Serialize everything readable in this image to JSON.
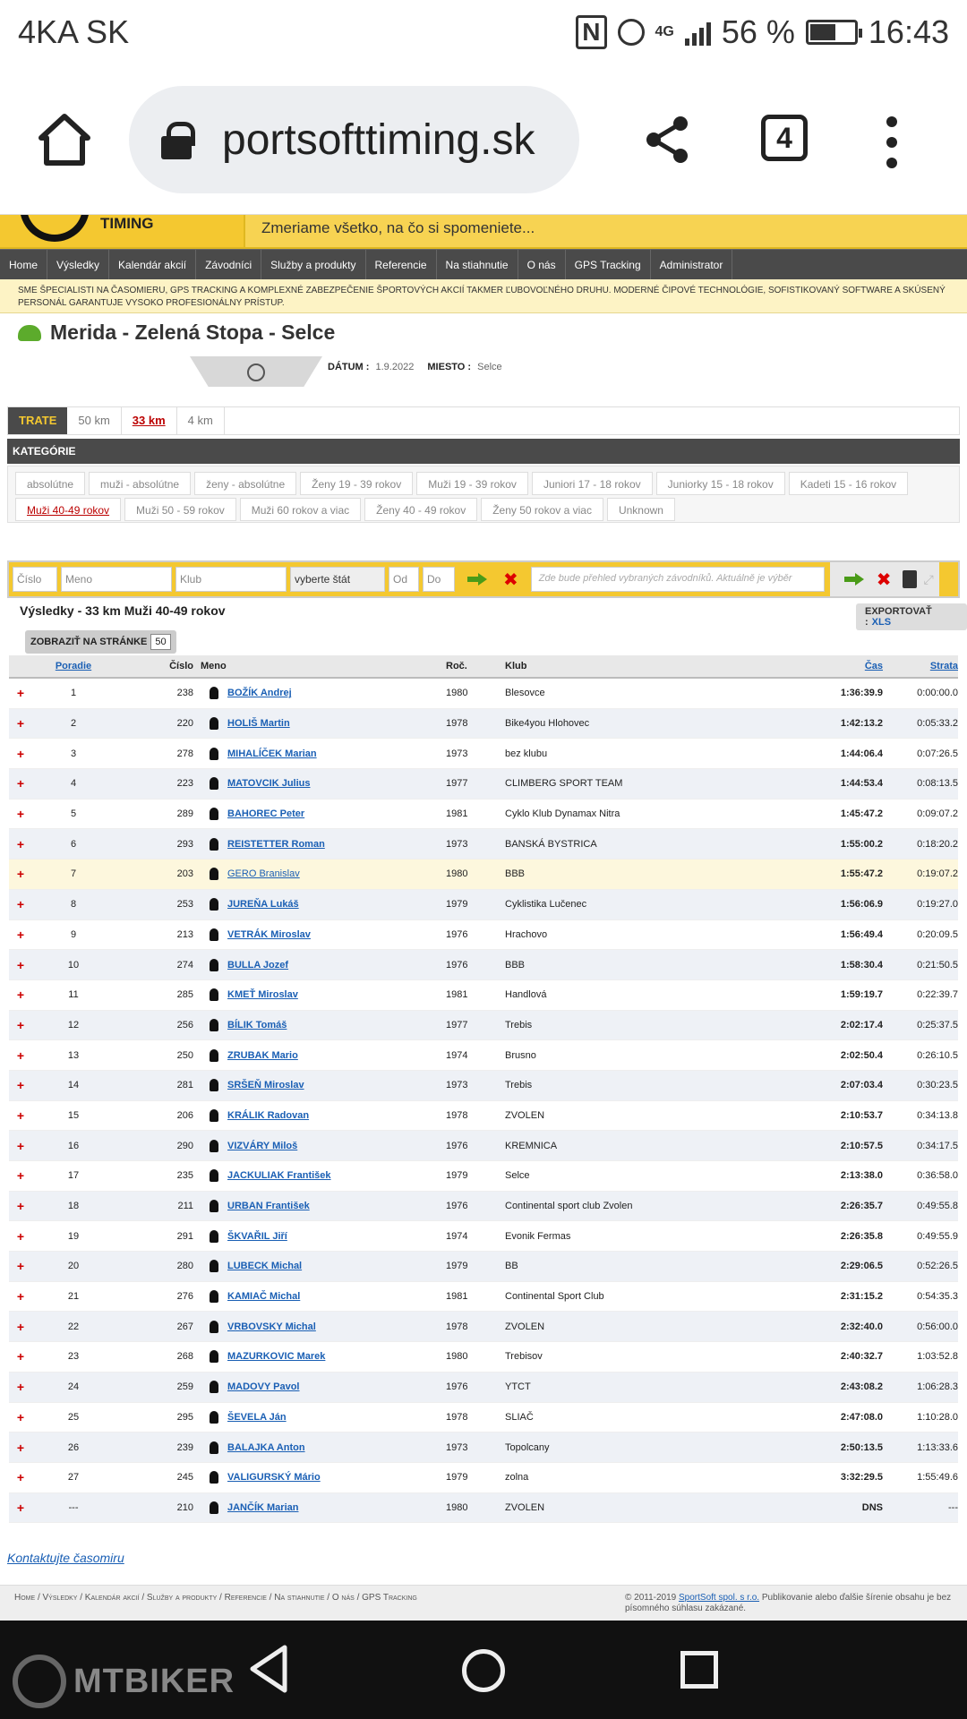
{
  "status": {
    "carrier": "4KA SK",
    "battery": "56 %",
    "time": "16:43",
    "signal": "4G"
  },
  "browser": {
    "url": "portsofttiming.sk",
    "tabs": "4"
  },
  "site": {
    "logo_text": "TIMING",
    "tagline": "Zmeriame všetko, na čo si spomeniete...",
    "nav": [
      "Home",
      "Výsledky",
      "Kalendár akcií",
      "Závodníci",
      "Služby a produkty",
      "Referencie",
      "Na stiahnutie",
      "O nás",
      "GPS Tracking",
      "Administrator"
    ],
    "notice": "Sme špecialisti na časomieru, GPS tracking a komplexné zabezpečenie športových akcií takmer ľubovoľného druhu. Moderné čipové technológie, sofistikovaný software a skúsený personál garantuje vysoko profesionálny prístup."
  },
  "event": {
    "title": "Merida - Zelená Stopa - Selce",
    "date_label": "DÁTUM :",
    "date": "1.9.2022",
    "place_label": "MIESTO :",
    "place": "Selce"
  },
  "tracks": {
    "label": "TRATE",
    "items": [
      "50 km",
      "33 km",
      "4 km"
    ]
  },
  "categories": {
    "label": "KATEGÓRIE",
    "items": [
      "absolútne",
      "muži - absolútne",
      "ženy - absolútne",
      "Ženy 19 - 39 rokov",
      "Muži 19 - 39 rokov",
      "Juniori 17 - 18 rokov",
      "Juniorky 15 - 18 rokov",
      "Kadeti 15 - 16 rokov",
      "Muži 40-49 rokov",
      "Muži 50 - 59 rokov",
      "Muži 60 rokov a viac",
      "Ženy 40 - 49 rokov",
      "Ženy 50 rokov a viac",
      "Unknown"
    ]
  },
  "filter": {
    "cislo": "Číslo",
    "meno": "Meno",
    "klub": "Klub",
    "stat": "vyberte štát",
    "od": "Od",
    "do": "Do",
    "preview": "Zde bude přehled vybraných závodníků. Aktuálně je výběr"
  },
  "results": {
    "heading": "Výsledky - 33 km Muži 40-49 rokov",
    "export_label": "EXPORTOVAŤ :",
    "export_xls": "XLS",
    "perpage_label": "ZOBRAZIŤ NA STRÁNKE",
    "perpage": "50"
  },
  "table": {
    "headers": {
      "poradie": "Poradie",
      "cislo": "Číslo",
      "meno": "Meno",
      "roc": "Roč.",
      "klub": "Klub",
      "cas": "Čas",
      "strata": "Strata"
    },
    "rows": [
      {
        "p": "1",
        "c": "238",
        "m": "BOŽÍK Andrej",
        "r": "1980",
        "k": "Blesovce",
        "t": "1:36:39.9",
        "s": "0:00:00.0"
      },
      {
        "p": "2",
        "c": "220",
        "m": "HOLIŠ Martin",
        "r": "1978",
        "k": "Bike4you Hlohovec",
        "t": "1:42:13.2",
        "s": "0:05:33.2"
      },
      {
        "p": "3",
        "c": "278",
        "m": "MIHALÍČEK Marian",
        "r": "1973",
        "k": "bez klubu",
        "t": "1:44:06.4",
        "s": "0:07:26.5"
      },
      {
        "p": "4",
        "c": "223",
        "m": "MATOVCIK Julius",
        "r": "1977",
        "k": "CLIMBERG SPORT TEAM",
        "t": "1:44:53.4",
        "s": "0:08:13.5"
      },
      {
        "p": "5",
        "c": "289",
        "m": "BAHOREC Peter",
        "r": "1981",
        "k": "Cyklo Klub Dynamax Nitra",
        "t": "1:45:47.2",
        "s": "0:09:07.2"
      },
      {
        "p": "6",
        "c": "293",
        "m": "REISTETTER Roman",
        "r": "1973",
        "k": "BANSKÁ BYSTRICA",
        "t": "1:55:00.2",
        "s": "0:18:20.2"
      },
      {
        "p": "7",
        "c": "203",
        "m": "GERO Branislav",
        "r": "1980",
        "k": "BBB",
        "t": "1:55:47.2",
        "s": "0:19:07.2"
      },
      {
        "p": "8",
        "c": "253",
        "m": "JUREŇA Lukáš",
        "r": "1979",
        "k": "Cyklistika Lučenec",
        "t": "1:56:06.9",
        "s": "0:19:27.0"
      },
      {
        "p": "9",
        "c": "213",
        "m": "VETRÁK Miroslav",
        "r": "1976",
        "k": "Hrachovo",
        "t": "1:56:49.4",
        "s": "0:20:09.5"
      },
      {
        "p": "10",
        "c": "274",
        "m": "BULLA Jozef",
        "r": "1976",
        "k": "BBB",
        "t": "1:58:30.4",
        "s": "0:21:50.5"
      },
      {
        "p": "11",
        "c": "285",
        "m": "KMEŤ Miroslav",
        "r": "1981",
        "k": "Handlová",
        "t": "1:59:19.7",
        "s": "0:22:39.7"
      },
      {
        "p": "12",
        "c": "256",
        "m": "BÍLIK Tomáš",
        "r": "1977",
        "k": "Trebis",
        "t": "2:02:17.4",
        "s": "0:25:37.5"
      },
      {
        "p": "13",
        "c": "250",
        "m": "ZRUBAK Mario",
        "r": "1974",
        "k": "Brusno",
        "t": "2:02:50.4",
        "s": "0:26:10.5"
      },
      {
        "p": "14",
        "c": "281",
        "m": "SRŠEŇ Miroslav",
        "r": "1973",
        "k": "Trebis",
        "t": "2:07:03.4",
        "s": "0:30:23.5"
      },
      {
        "p": "15",
        "c": "206",
        "m": "KRÁLIK Radovan",
        "r": "1978",
        "k": "ZVOLEN",
        "t": "2:10:53.7",
        "s": "0:34:13.8"
      },
      {
        "p": "16",
        "c": "290",
        "m": "VIZVÁRY Miloš",
        "r": "1976",
        "k": "KREMNICA",
        "t": "2:10:57.5",
        "s": "0:34:17.5"
      },
      {
        "p": "17",
        "c": "235",
        "m": "JACKULIAK František",
        "r": "1979",
        "k": "Selce",
        "t": "2:13:38.0",
        "s": "0:36:58.0"
      },
      {
        "p": "18",
        "c": "211",
        "m": "URBAN František",
        "r": "1976",
        "k": "Continental sport club Zvolen",
        "t": "2:26:35.7",
        "s": "0:49:55.8"
      },
      {
        "p": "19",
        "c": "291",
        "m": "ŠKVAŘIL Jiří",
        "r": "1974",
        "k": "Evonik Fermas",
        "t": "2:26:35.8",
        "s": "0:49:55.9"
      },
      {
        "p": "20",
        "c": "280",
        "m": "LUBECK Michal",
        "r": "1979",
        "k": "BB",
        "t": "2:29:06.5",
        "s": "0:52:26.5"
      },
      {
        "p": "21",
        "c": "276",
        "m": "KAMIAČ Michal",
        "r": "1981",
        "k": "Continental Sport Club",
        "t": "2:31:15.2",
        "s": "0:54:35.3"
      },
      {
        "p": "22",
        "c": "267",
        "m": "VRBOVSKY Michal",
        "r": "1978",
        "k": "ZVOLEN",
        "t": "2:32:40.0",
        "s": "0:56:00.0"
      },
      {
        "p": "23",
        "c": "268",
        "m": "MAZURKOVIC Marek",
        "r": "1980",
        "k": "Trebisov",
        "t": "2:40:32.7",
        "s": "1:03:52.8"
      },
      {
        "p": "24",
        "c": "259",
        "m": "MADOVY Pavol",
        "r": "1976",
        "k": "YTCT",
        "t": "2:43:08.2",
        "s": "1:06:28.3"
      },
      {
        "p": "25",
        "c": "295",
        "m": "ŠEVELA Ján",
        "r": "1978",
        "k": "SLIAČ",
        "t": "2:47:08.0",
        "s": "1:10:28.0"
      },
      {
        "p": "26",
        "c": "239",
        "m": "BALAJKA Anton",
        "r": "1973",
        "k": "Topolcany",
        "t": "2:50:13.5",
        "s": "1:13:33.6"
      },
      {
        "p": "27",
        "c": "245",
        "m": "VALIGURSKÝ Mário",
        "r": "1979",
        "k": "zolna",
        "t": "3:32:29.5",
        "s": "1:55:49.6"
      },
      {
        "p": "---",
        "c": "210",
        "m": "JANČÍK Marian",
        "r": "1980",
        "k": "ZVOLEN",
        "t": "DNS",
        "s": "---"
      }
    ]
  },
  "contact": "Kontaktujte časomiru",
  "footer": {
    "links": "Home / Výsledky / Kalendár akcií / Služby a produkty / Referencie / Na stiahnutie / O nás / GPS Tracking",
    "copy_pre": "© 2011-2019 ",
    "company": "SportSoft spol. s r.o.",
    "copy_post": " Publikovanie alebo ďalšie šírenie obsahu je bez písomného súhlasu zakázané."
  },
  "watermark": "MTBIKER"
}
